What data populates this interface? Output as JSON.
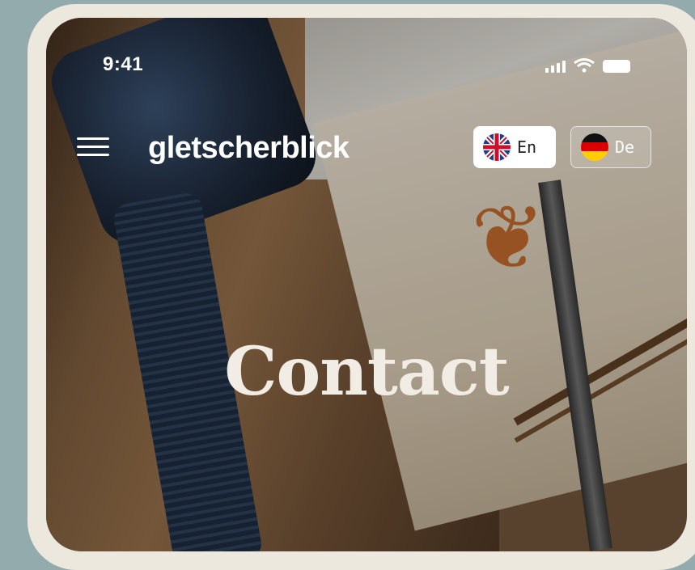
{
  "status_bar": {
    "time": "9:41"
  },
  "header": {
    "brand": "gletscherblick",
    "menu_icon": "hamburger-menu-icon"
  },
  "languages": [
    {
      "code": "En",
      "flag": "uk-flag-icon",
      "active": true
    },
    {
      "code": "De",
      "flag": "germany-flag-icon",
      "active": false
    }
  ],
  "hero": {
    "title": "Contact"
  },
  "colors": {
    "backdrop": "#93abac",
    "frame": "#ece8de",
    "title": "#f2ede4",
    "active_lang_bg": "#ffffff"
  }
}
